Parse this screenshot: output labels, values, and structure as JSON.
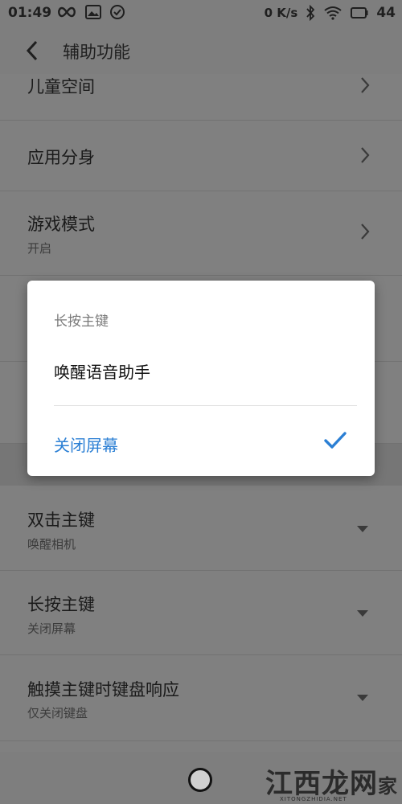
{
  "status_bar": {
    "time": "01:49",
    "net_speed": "0 K/s",
    "battery": "44",
    "icons": [
      "infinity-icon",
      "gallery-icon",
      "check-circle-icon",
      "bluetooth-icon",
      "wifi-icon",
      "battery-icon"
    ]
  },
  "header": {
    "title": "辅助功能"
  },
  "settings": {
    "kids_space": {
      "label": "儿童空间"
    },
    "app_clone": {
      "label": "应用分身"
    },
    "game_mode": {
      "label": "游戏模式",
      "value": "开启"
    },
    "double_press": {
      "label": "双击主键",
      "value": "唤醒相机"
    },
    "long_press": {
      "label": "长按主键",
      "value": "关闭屏幕"
    },
    "touch_keyboard": {
      "label": "触摸主键时键盘响应",
      "value": "仅关闭键盘"
    }
  },
  "dialog": {
    "title": "长按主键",
    "options": [
      {
        "label": "唤醒语音助手",
        "selected": false
      },
      {
        "label": "关闭屏幕",
        "selected": true
      }
    ]
  },
  "watermark": {
    "text": "江西龙网",
    "suffix": "家",
    "sub": "XITONGZHIDIA.NET"
  },
  "colors": {
    "accent": "#2b7fd4",
    "scrim": "#808080"
  }
}
